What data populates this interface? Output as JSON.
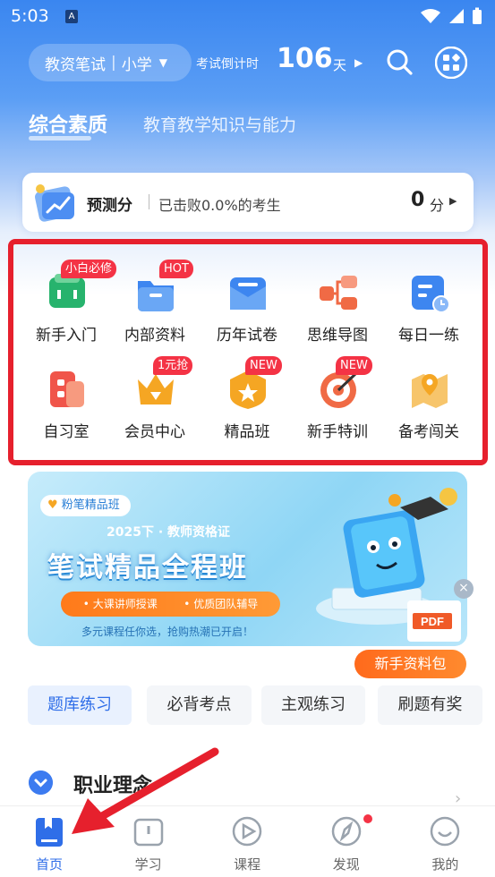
{
  "status_bar": {
    "time": "5:03",
    "app_badge": "A"
  },
  "header": {
    "exam_name": "教资笔试",
    "exam_level": "小学",
    "countdown_label": "考试倒计时",
    "countdown_days": "106",
    "countdown_unit": "天"
  },
  "subject_tabs": [
    {
      "label": "综合素质",
      "active": true
    },
    {
      "label": "教育教学知识与能力",
      "active": false
    }
  ],
  "predict": {
    "title": "预测分",
    "text": "已击败0.0%的考生",
    "score": "0",
    "unit": "分"
  },
  "grid": [
    {
      "label": "新手入门",
      "badge": "小白必修",
      "icon": "wallet-icon",
      "color": "#27b36d"
    },
    {
      "label": "内部资料",
      "badge": "HOT",
      "icon": "folder-icon",
      "color": "#3d86f0"
    },
    {
      "label": "历年试卷",
      "badge": "",
      "icon": "envelope-icon",
      "color": "#3d86f0"
    },
    {
      "label": "思维导图",
      "badge": "",
      "icon": "mindmap-icon",
      "color": "#f06a45"
    },
    {
      "label": "每日一练",
      "badge": "",
      "icon": "calendar-clock-icon",
      "color": "#3d86f0"
    },
    {
      "label": "自习室",
      "badge": "",
      "icon": "study-room-icon",
      "color": "#f0554a"
    },
    {
      "label": "会员中心",
      "badge": "1元抢",
      "icon": "crown-icon",
      "color": "#f5a623"
    },
    {
      "label": "精品班",
      "badge": "NEW",
      "icon": "star-shield-icon",
      "color": "#f5a623"
    },
    {
      "label": "新手特训",
      "badge": "NEW",
      "icon": "target-icon",
      "color": "#f06a45"
    },
    {
      "label": "备考闯关",
      "badge": "",
      "icon": "map-pin-icon",
      "color": "#f5a623"
    }
  ],
  "banner": {
    "tag": "粉笔精品班",
    "subtitle": "2025下 · 教师资格证",
    "title": "笔试精品全程班",
    "point1": "• 大课讲师授课",
    "point2": "• 优质团队辅导",
    "footnote": "多元课程任你选，抢购热潮已开启！",
    "pdf_label": "PDF",
    "cta": "新手资料包"
  },
  "practice_tabs": [
    {
      "label": "题库练习",
      "active": true
    },
    {
      "label": "必背考点",
      "active": false
    },
    {
      "label": "主观练习",
      "active": false
    },
    {
      "label": "刷题有奖",
      "active": false
    }
  ],
  "section": {
    "title": "职业理念"
  },
  "bottom_nav": [
    {
      "label": "首页",
      "icon": "home-book-icon",
      "active": true,
      "dot": false
    },
    {
      "label": "学习",
      "icon": "study-icon",
      "active": false,
      "dot": false
    },
    {
      "label": "课程",
      "icon": "play-icon",
      "active": false,
      "dot": false
    },
    {
      "label": "发现",
      "icon": "compass-icon",
      "active": false,
      "dot": true
    },
    {
      "label": "我的",
      "icon": "profile-icon",
      "active": false,
      "dot": false
    }
  ],
  "colors": {
    "primary": "#2f6ee8",
    "highlight_frame": "#e6202d",
    "badge": "#f43345",
    "orange": "#ff7a1a"
  }
}
